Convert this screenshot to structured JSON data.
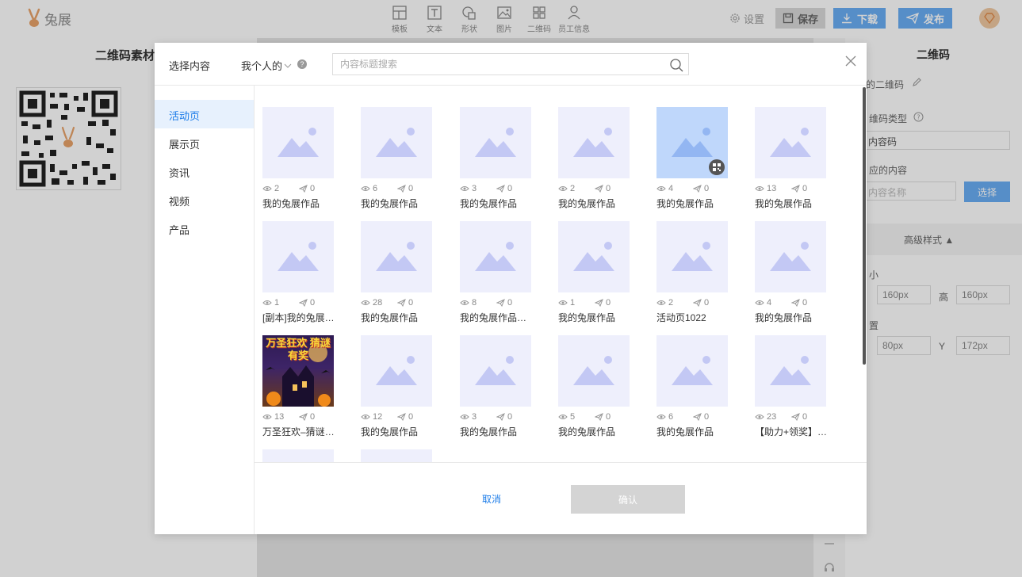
{
  "app": {
    "logo_text": "兔展",
    "tools": [
      {
        "label": "模板",
        "icon": "template-icon"
      },
      {
        "label": "文本",
        "icon": "text-icon"
      },
      {
        "label": "形状",
        "icon": "shape-icon"
      },
      {
        "label": "图片",
        "icon": "image-icon"
      },
      {
        "label": "二维码",
        "icon": "qrcode-icon"
      },
      {
        "label": "员工信息",
        "icon": "person-icon"
      }
    ],
    "settings_label": "设置",
    "save_label": "保存",
    "download_label": "下载",
    "publish_label": "发布"
  },
  "left_panel": {
    "title": "二维码素材"
  },
  "right_panel": {
    "title": "二维码",
    "name_label": "的二维码",
    "type_label": "维码类型",
    "type_value": "内容码",
    "content_label": "应的内容",
    "content_placeholder": "内容名称",
    "choose_label": "选择",
    "advanced_label": "高级样式",
    "size_label": "小",
    "width_value": "160px",
    "height_label": "高",
    "height_value": "160px",
    "position_label": "置",
    "x_value": "80px",
    "y_label": "Y",
    "y_value": "172px"
  },
  "modal": {
    "title": "选择内容",
    "scope_label": "我个人的",
    "help": "?",
    "search_placeholder": "内容标题搜索",
    "nav": [
      {
        "label": "活动页",
        "active": true
      },
      {
        "label": "展示页",
        "active": false
      },
      {
        "label": "资讯",
        "active": false
      },
      {
        "label": "视频",
        "active": false
      },
      {
        "label": "产品",
        "active": false
      }
    ],
    "items": [
      {
        "views": "2",
        "shares": "0",
        "name": "我的兔展作品"
      },
      {
        "views": "6",
        "shares": "0",
        "name": "我的兔展作品"
      },
      {
        "views": "3",
        "shares": "0",
        "name": "我的兔展作品"
      },
      {
        "views": "2",
        "shares": "0",
        "name": "我的兔展作品"
      },
      {
        "views": "4",
        "shares": "0",
        "name": "我的兔展作品",
        "selected": true
      },
      {
        "views": "13",
        "shares": "0",
        "name": "我的兔展作品"
      },
      {
        "views": "1",
        "shares": "0",
        "name": "[副本]我的兔展作品"
      },
      {
        "views": "28",
        "shares": "0",
        "name": "我的兔展作品"
      },
      {
        "views": "8",
        "shares": "0",
        "name": "我的兔展作品作品"
      },
      {
        "views": "1",
        "shares": "0",
        "name": "我的兔展作品"
      },
      {
        "views": "2",
        "shares": "0",
        "name": "活动页1022"
      },
      {
        "views": "4",
        "shares": "0",
        "name": "我的兔展作品"
      },
      {
        "views": "13",
        "shares": "0",
        "name": "万圣狂欢–猜谜有奖",
        "poster": true
      },
      {
        "views": "12",
        "shares": "0",
        "name": "我的兔展作品"
      },
      {
        "views": "3",
        "shares": "0",
        "name": "我的兔展作品"
      },
      {
        "views": "5",
        "shares": "0",
        "name": "我的兔展作品"
      },
      {
        "views": "6",
        "shares": "0",
        "name": "我的兔展作品"
      },
      {
        "views": "23",
        "shares": "0",
        "name": "【助力+领奖】活动"
      }
    ],
    "poster_text": "万圣狂欢 猜谜有奖",
    "cancel_label": "取消",
    "confirm_label": "确认"
  },
  "colors": {
    "accent": "#1a7be8",
    "primary_button": "#6aaef5",
    "thumb_bg": "#eeeffc",
    "thumb_selected": "#bfd7fb",
    "confirm_disabled": "#d4d4d4"
  }
}
